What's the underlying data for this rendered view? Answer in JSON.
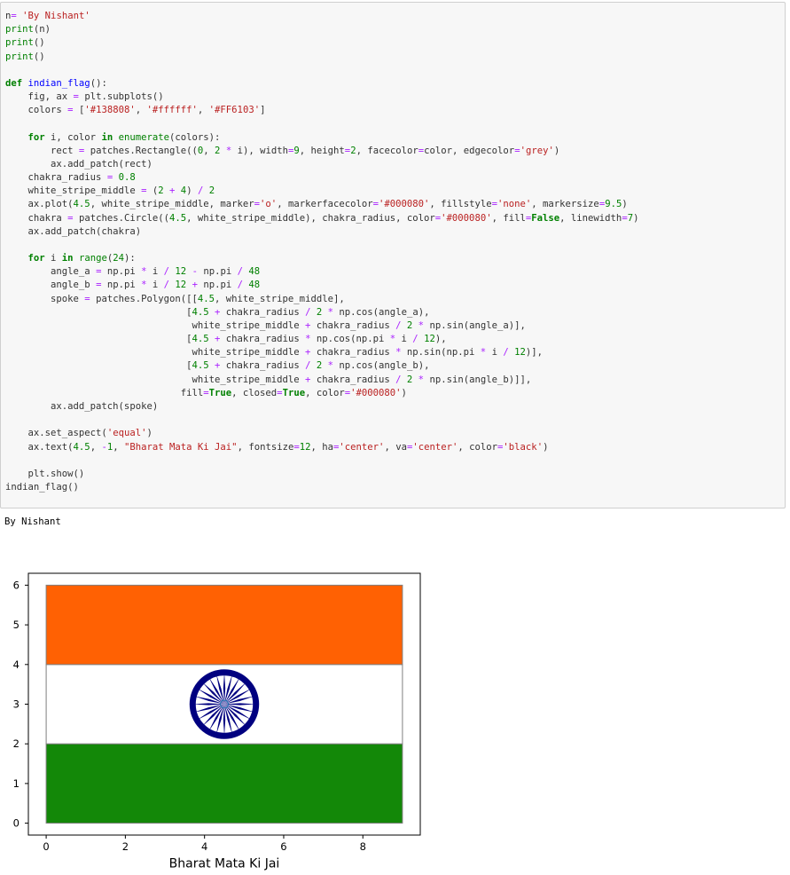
{
  "code_lines": [
    "n= 'By Nishant'",
    "print(n)",
    "print()",
    "print()",
    "",
    "def indian_flag():",
    "    fig, ax = plt.subplots()",
    "    colors = ['#138808', '#ffffff', '#FF6103']",
    "",
    "    for i, color in enumerate(colors):",
    "        rect = patches.Rectangle((0, 2 * i), width=9, height=2, facecolor=color, edgecolor='grey')",
    "        ax.add_patch(rect)",
    "    chakra_radius = 0.8",
    "    white_stripe_middle = (2 + 4) / 2",
    "    ax.plot(4.5, white_stripe_middle, marker='o', markerfacecolor='#000080', fillstyle='none', markersize=9.5)",
    "    chakra = patches.Circle((4.5, white_stripe_middle), chakra_radius, color='#000080', fill=False, linewidth=7)",
    "    ax.add_patch(chakra)",
    "",
    "    for i in range(24):",
    "        angle_a = np.pi * i / 12 - np.pi / 48",
    "        angle_b = np.pi * i / 12 + np.pi / 48",
    "        spoke = patches.Polygon([[4.5, white_stripe_middle],",
    "                                [4.5 + chakra_radius / 2 * np.cos(angle_a),",
    "                                 white_stripe_middle + chakra_radius / 2 * np.sin(angle_a)],",
    "                                [4.5 + chakra_radius * np.cos(np.pi * i / 12),",
    "                                 white_stripe_middle + chakra_radius * np.sin(np.pi * i / 12)],",
    "                                [4.5 + chakra_radius / 2 * np.cos(angle_b),",
    "                                 white_stripe_middle + chakra_radius / 2 * np.sin(angle_b)]],",
    "                               fill=True, closed=True, color='#000080')",
    "        ax.add_patch(spoke)",
    "",
    "    ax.set_aspect('equal')",
    "    ax.text(4.5, -1, \"Bharat Mata Ki Jai\", fontsize=12, ha='center', va='center', color='black')",
    "",
    "    plt.show()",
    "indian_flag()"
  ],
  "output_text": "By Nishant",
  "chart_data": {
    "type": "flag-plot",
    "xlim": [
      -0.45,
      9.45
    ],
    "ylim": [
      -0.3,
      6.3
    ],
    "x_ticks": [
      0,
      2,
      4,
      6,
      8
    ],
    "y_ticks": [
      0,
      1,
      2,
      3,
      4,
      5,
      6
    ],
    "stripes": [
      {
        "y": 0,
        "height": 2,
        "width": 9,
        "color": "#138808"
      },
      {
        "y": 2,
        "height": 2,
        "width": 9,
        "color": "#ffffff"
      },
      {
        "y": 4,
        "height": 2,
        "width": 9,
        "color": "#FF6103"
      }
    ],
    "stripe_edge_color": "grey",
    "chakra": {
      "cx": 4.5,
      "cy": 3,
      "radius": 0.8,
      "color": "#000080",
      "spokes": 24
    },
    "annotation": {
      "x": 4.5,
      "y": -1,
      "text": "Bharat Mata Ki Jai"
    }
  }
}
